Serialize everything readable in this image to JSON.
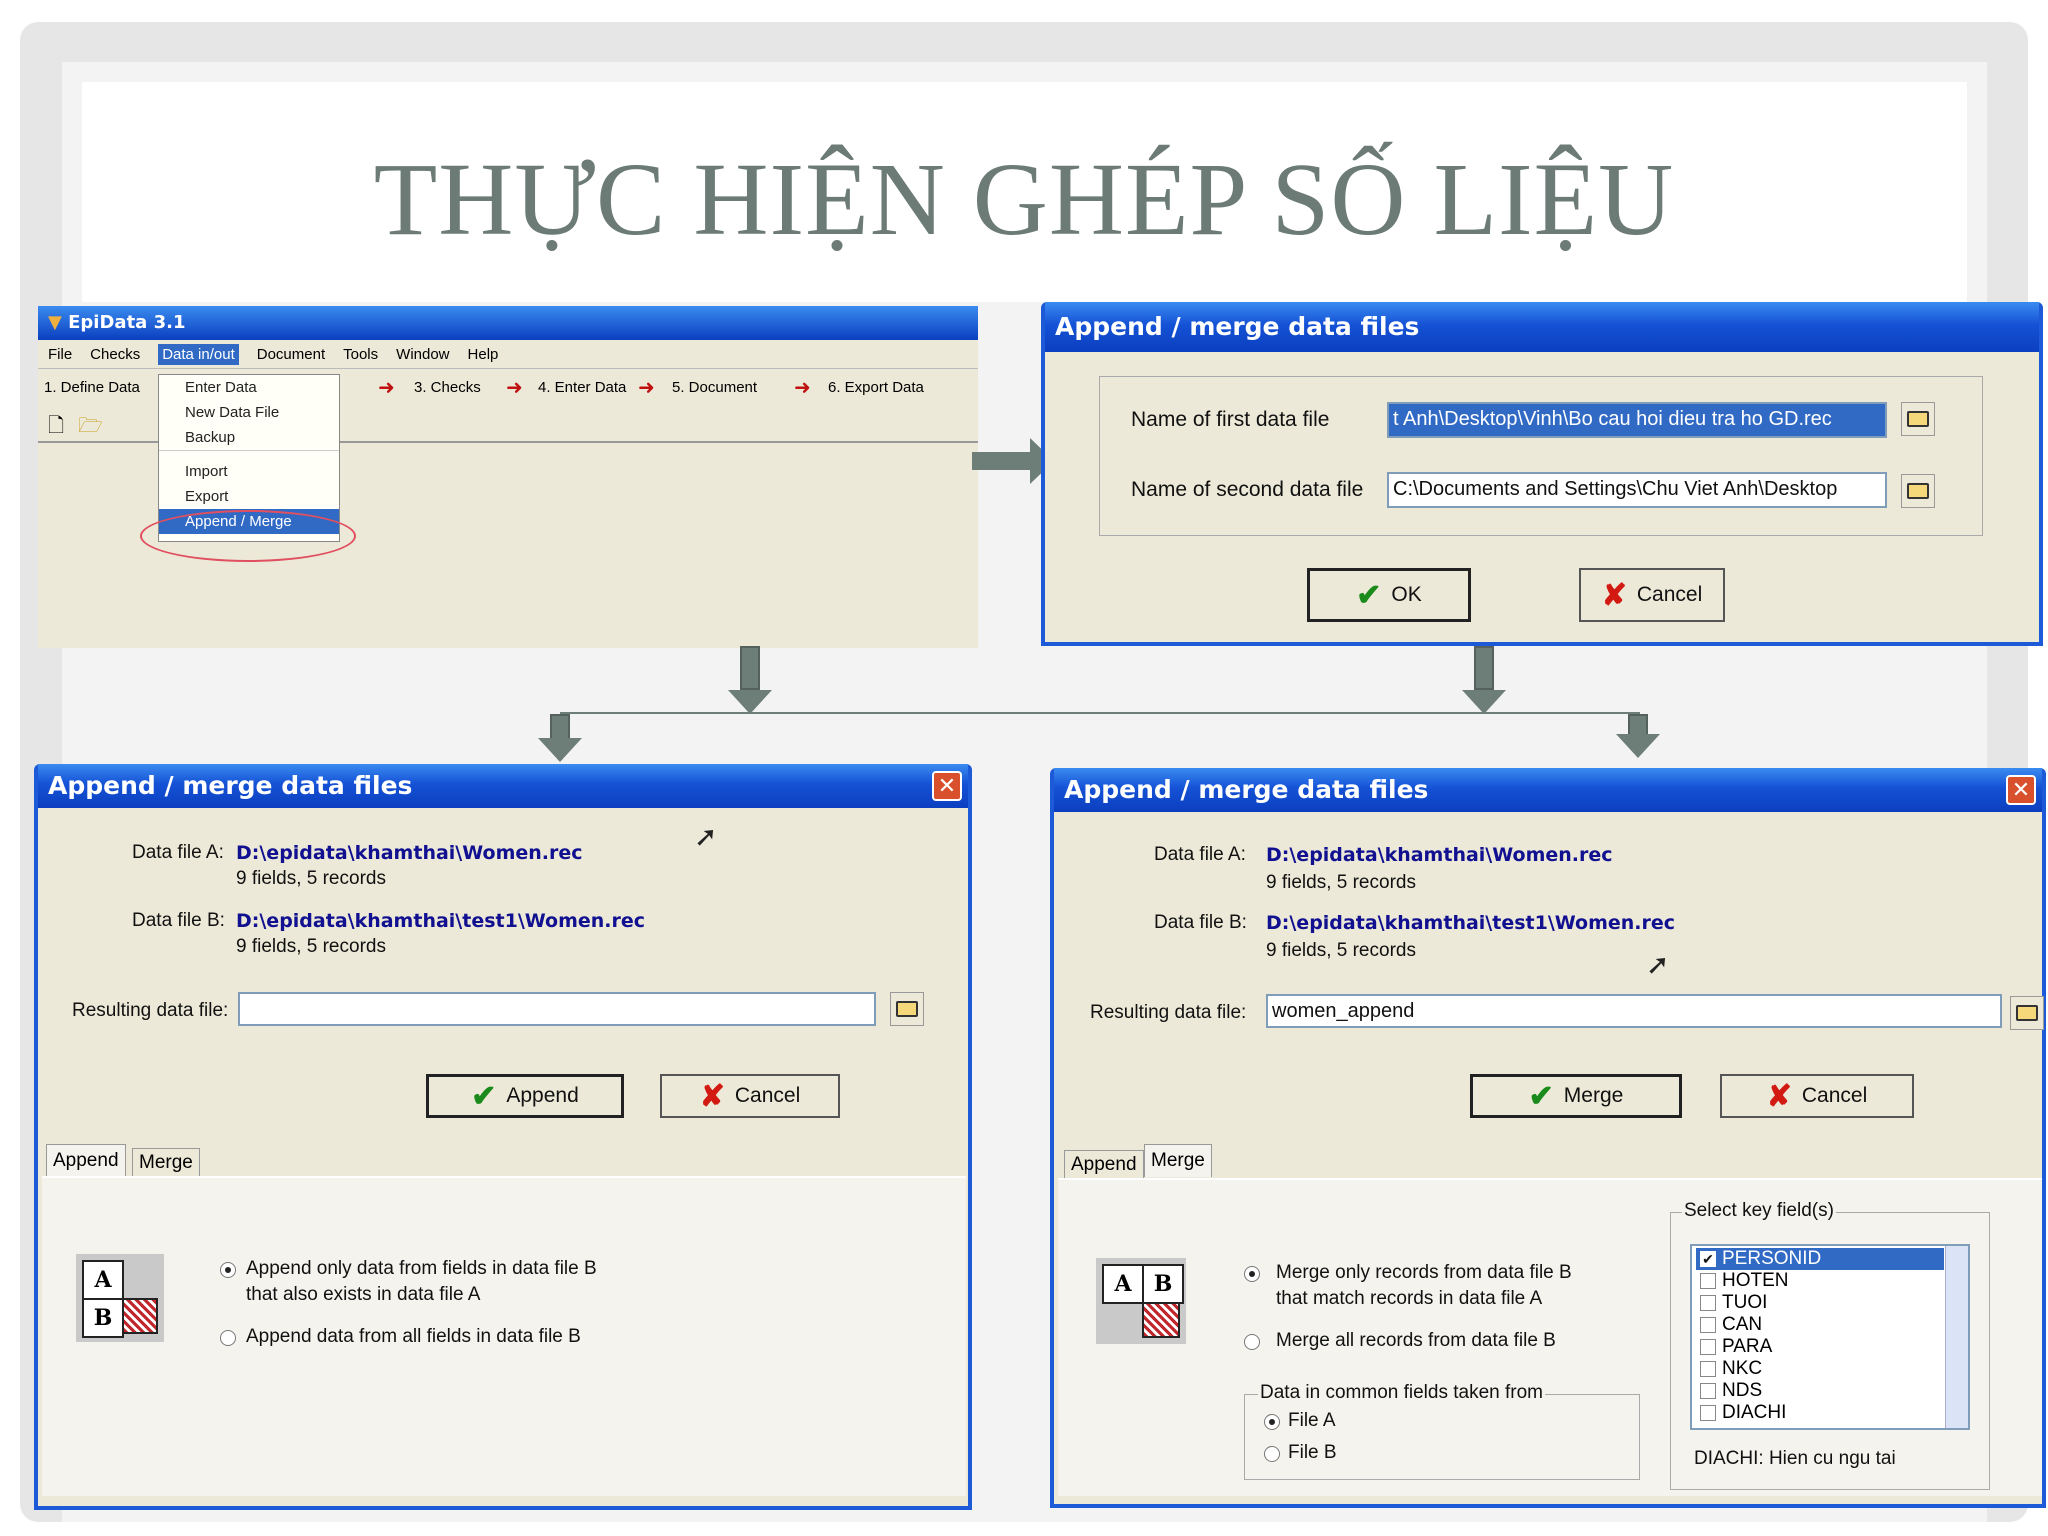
{
  "slide": {
    "title": "THỰC HIỆN GHÉP SỐ LIỆU"
  },
  "epidata": {
    "window_title": "EpiData 3.1",
    "menubar": [
      "File",
      "Checks",
      "Data in/out",
      "Document",
      "Tools",
      "Window",
      "Help"
    ],
    "steps": [
      "1. Define Data",
      "3. Checks",
      "4. Enter Data",
      "5. Document",
      "6. Export Data"
    ],
    "dropdown": [
      "Enter Data",
      "New Data File",
      "Backup",
      "Import",
      "Export",
      "Append / Merge"
    ],
    "highlighted_item": "Append / Merge"
  },
  "dialog_select": {
    "title": "Append / merge data files",
    "first_label": "Name of first data file",
    "first_value": "t Anh\\Desktop\\Vinh\\Bo cau hoi dieu tra ho GD.rec",
    "second_label": "Name of second data file",
    "second_value": "C:\\Documents and Settings\\Chu Viet Anh\\Desktop",
    "ok_label": "OK",
    "cancel_label": "Cancel"
  },
  "dialog_append": {
    "title": "Append / merge data files",
    "file_a_label": "Data file A:",
    "file_a_path": "D:\\epidata\\khamthai\\Women.rec",
    "file_a_info": "9 fields, 5 records",
    "file_b_label": "Data file B:",
    "file_b_path": "D:\\epidata\\khamthai\\test1\\Women.rec",
    "file_b_info": "9 fields, 5 records",
    "result_label": "Resulting data file:",
    "result_value": "",
    "action_label": "Append",
    "cancel_label": "Cancel",
    "tabs": [
      "Append",
      "Merge"
    ],
    "active_tab": "Append",
    "option1_line1": "Append only data from fields in data file B",
    "option1_line2": "that also exists in data file A",
    "option2": "Append data from all fields in data file B",
    "icon_letters": [
      "A",
      "B"
    ]
  },
  "dialog_merge": {
    "title": "Append / merge data files",
    "file_a_label": "Data file A:",
    "file_a_path": "D:\\epidata\\khamthai\\Women.rec",
    "file_a_info": "9 fields, 5 records",
    "file_b_label": "Data file B:",
    "file_b_path": "D:\\epidata\\khamthai\\test1\\Women.rec",
    "file_b_info": "9 fields, 5 records",
    "result_label": "Resulting data file:",
    "result_value": "women_append",
    "action_label": "Merge",
    "cancel_label": "Cancel",
    "tabs": [
      "Append",
      "Merge"
    ],
    "active_tab": "Merge",
    "option1_line1": "Merge only records from data file B",
    "option1_line2": "that match records in data file A",
    "option2": "Merge all records from data file B",
    "common_group_label": "Data in common fields taken from",
    "common_options": [
      "File A",
      "File B"
    ],
    "key_group_label": "Select key field(s)",
    "key_fields": [
      "PERSONID",
      "HOTEN",
      "TUOI",
      "CAN",
      "PARA",
      "NKC",
      "NDS",
      "DIACHI"
    ],
    "key_checked": "PERSONID",
    "status_text": "DIACHI: Hien cu ngu tai",
    "icon_letters": [
      "A",
      "B"
    ]
  }
}
